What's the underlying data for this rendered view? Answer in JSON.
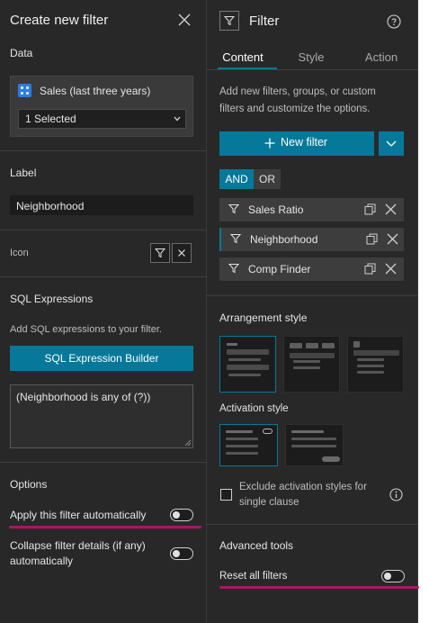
{
  "left_panel": {
    "header_title": "Create new filter",
    "data_section": {
      "title": "Data",
      "source_name": "Sales (last three years)",
      "select_value": "1 Selected"
    },
    "label_section": {
      "title": "Label",
      "value": "Neighborhood"
    },
    "icon_section": {
      "title": "Icon",
      "icon": "filter-icon"
    },
    "sql_section": {
      "title": "SQL Expressions",
      "description": "Add SQL expressions to your filter.",
      "builder_button": "SQL Expression Builder",
      "expression": "(Neighborhood is any of (?))"
    },
    "options_section": {
      "title": "Options",
      "apply_auto_label": "Apply this filter automatically",
      "collapse_label_line1": "Collapse filter details (if any)",
      "collapse_label_line2": "automatically"
    }
  },
  "right_panel": {
    "header_title": "Filter",
    "header_icon": "filter-icon",
    "help_icon": "help-icon",
    "tabs": [
      {
        "label": "Content",
        "active": true
      },
      {
        "label": "Style",
        "active": false
      },
      {
        "label": "Action",
        "active": false
      }
    ],
    "description_line1": "Add new filters, groups, or custom",
    "description_line2": "filters and customize the options.",
    "new_filter_button": "New filter",
    "logic": {
      "and": "AND",
      "or": "OR",
      "selected": "AND"
    },
    "filters": [
      {
        "label": "Sales Ratio",
        "selected": false
      },
      {
        "label": "Neighborhood",
        "selected": true
      },
      {
        "label": "Comp Finder",
        "selected": false
      }
    ],
    "arrangement_title": "Arrangement style",
    "activation_title": "Activation style",
    "exclude_line1": "Exclude activation styles for",
    "exclude_line2": "single clause",
    "advanced_title": "Advanced tools",
    "reset_label": "Reset all filters"
  },
  "colors": {
    "accent": "#06799a",
    "highlight_underline": "#b0126b",
    "panel_bg": "#282828"
  }
}
